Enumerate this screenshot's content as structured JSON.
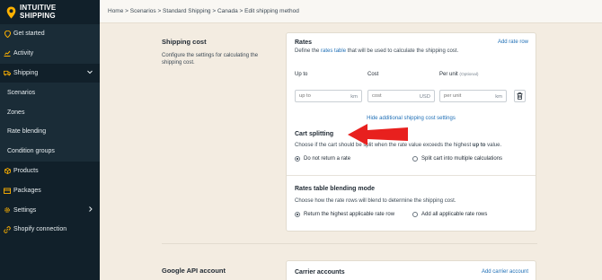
{
  "app": {
    "logo_line1": "INTUITIVE",
    "logo_line2": "SHIPPING"
  },
  "sidebar": {
    "items": [
      {
        "label": "Get started",
        "icon": "pin-icon"
      },
      {
        "label": "Activity",
        "icon": "chart-icon"
      },
      {
        "label": "Shipping",
        "icon": "truck-icon"
      },
      {
        "label": "Scenarios"
      },
      {
        "label": "Zones"
      },
      {
        "label": "Rate blending"
      },
      {
        "label": "Condition groups"
      },
      {
        "label": "Products",
        "icon": "box-icon"
      },
      {
        "label": "Packages",
        "icon": "package-icon"
      },
      {
        "label": "Settings",
        "icon": "gear-icon"
      },
      {
        "label": "Shopify connection",
        "icon": "link-icon"
      }
    ]
  },
  "breadcrumb": "Home > Scenarios > Standard Shipping > Canada > Edit shipping method",
  "shipping_cost": {
    "title": "Shipping cost",
    "description": "Configure the settings for calculating the shipping cost."
  },
  "rates": {
    "title": "Rates",
    "description_prefix": "Define the ",
    "description_link": "rates table",
    "description_suffix": " that will be used to calculate the shipping cost.",
    "add_rate_row": "Add rate row",
    "col_up_to": "Up to",
    "col_cost": "Cost",
    "col_per_unit": "Per unit",
    "col_optional": "(Optional)",
    "up_to_placeholder": "up to",
    "up_to_unit": "km",
    "cost_placeholder": "cost",
    "cost_unit": "USD",
    "per_unit_placeholder": "per unit",
    "per_unit_unit": "km",
    "hide_link": "Hide additional shipping cost settings"
  },
  "cart_splitting": {
    "title": "Cart splitting",
    "description_prefix": "Choose if the cart should be split when the rate value exceeds the highest ",
    "description_bold": "up to",
    "description_suffix": " value.",
    "option_1": "Do not return a rate",
    "option_2": "Split cart into multiple calculations"
  },
  "blending": {
    "title": "Rates table blending mode",
    "description": "Choose how the rate rows will blend to determine the shipping cost.",
    "option_1": "Return the highest applicable rate row",
    "option_2": "Add all applicable rate rows"
  },
  "google_api": {
    "title": "Google API account"
  },
  "carrier": {
    "title": "Carrier accounts",
    "add_link": "Add carrier account"
  },
  "colors": {
    "sidebar_bg": "#11202a",
    "accent": "#ffb200",
    "link": "#1f6fb6",
    "arrow": "#e8201e",
    "page_bg": "#f3ece1"
  }
}
